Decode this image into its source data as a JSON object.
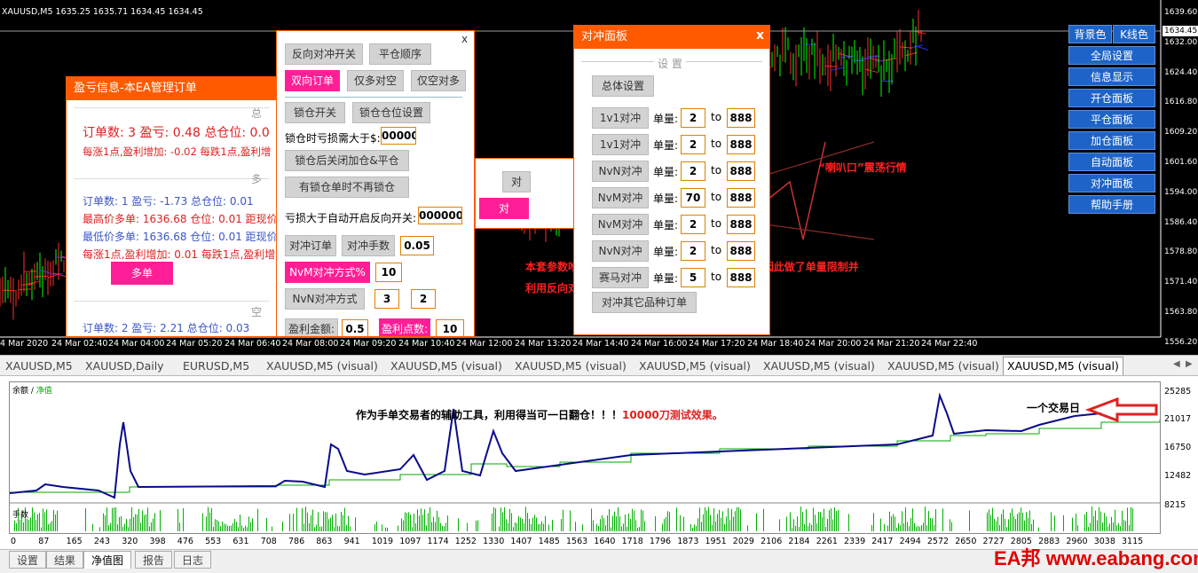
{
  "chart": {
    "symbol_line": "XAUUSD,M5  1635.25 1635.71 1634.45 1634.45",
    "price_labels": [
      "1639.60",
      "1632.00",
      "1624.40",
      "1616.80",
      "1609.20",
      "1601.60",
      "1594.00",
      "1586.40",
      "1578.80",
      "1571.40",
      "1563.80",
      "1556.20"
    ],
    "current_price": "1634.45",
    "time_labels": [
      "4 Mar 2020",
      "24 Mar 02:40",
      "24 Mar 04:00",
      "24 Mar 05:20",
      "24 Mar 06:40",
      "24 Mar 08:00",
      "24 Mar 09:20",
      "24 Mar 10:40",
      "24 Mar 12:00",
      "24 Mar 13:20",
      "24 Mar 14:40",
      "24 Mar 16:00",
      "24 Mar 17:20",
      "24 Mar 18:40",
      "24 Mar 20:00",
      "24 Mar 21:20",
      "24 Mar 22:40"
    ],
    "annotation_trumpet": "“喇叭口”震荡行情",
    "annotation_note_1": "本套参数唯一的缺陷是遇到“喇叭口”震荡会爆仓，因此做了单量限制并",
    "annotation_note_2": "利用反向对冲解套。"
  },
  "right_menu": {
    "bg_color_btn": "背景色",
    "kline_color_btn": "K线色",
    "items": [
      "全局设置",
      "信息显示",
      "开仓面板",
      "平仓面板",
      "加仓面板",
      "自动面板",
      "对冲面板",
      "帮助手册"
    ]
  },
  "profit_panel": {
    "title": "盈亏信息-本EA管理订单",
    "section_total": "总",
    "total_line": "订单数: 3  盈亏: 0.48  总仓位: 0.0",
    "total_sub": "每涨1点,盈利增加: -0.02    每跌1点,盈利增",
    "section_long": "多",
    "long_lines": [
      "订单数: 1  盈亏: -1.73  总仓位: 0.01",
      "最高价多单: 1636.68  仓位: 0.01  距现价",
      "最低价多单: 1636.68  仓位: 0.01  距现价",
      "每涨1点,盈利增加: 0.01    每跌1点,盈利增"
    ],
    "section_short": "空",
    "short_line": "订单数: 2  盈亏: 2.21  总仓位: 0.03",
    "btn_partial": "多单"
  },
  "settings_panel": {
    "close": "x",
    "btn_reverse_hedge": "反向对冲开关",
    "btn_close_order": "平仓顺序",
    "btn_two_way": "双向订单",
    "btn_long_vs_short": "仅多对空",
    "btn_short_vs_long": "仅空对多",
    "btn_lock_switch": "锁仓开关",
    "btn_lock_position": "锁仓仓位设置",
    "lock_loss_label": "锁仓时亏损需大于$:",
    "lock_loss_value": "000000",
    "btn_close_after_lock": "锁仓后关闭加仓&平仓",
    "btn_no_relock": "有锁仓单时不再锁仓",
    "auto_reverse_label": "亏损大于自动开启反向开关:",
    "auto_reverse_value": "0000000",
    "btn_hedge_order": "对冲订单",
    "btn_hedge_lots": "对冲手数",
    "hedge_lots_value": "0.05",
    "btn_nvm_pct": "NvM对冲方式%",
    "nvm_pct_value": "10",
    "btn_nvn_mode": "NvN对冲方式",
    "nvn_a": "3",
    "nvn_b": "2",
    "btn_profit_amount": "盈利金额:",
    "profit_amount_value": "0.5",
    "btn_profit_points": "盈利点数:",
    "profit_points_value": "10"
  },
  "hedge_panel": {
    "title": "对冲面板",
    "close": "x",
    "section_settings": "设 置",
    "btn_general": "总体设置",
    "rows": [
      {
        "btn": "1v1对冲",
        "label": "单量:",
        "from": "2",
        "to_text": "to",
        "to": "888"
      },
      {
        "btn": "1v1对冲",
        "label": "单量:",
        "from": "2",
        "to_text": "to",
        "to": "888"
      },
      {
        "btn": "NvN对冲",
        "label": "单量:",
        "from": "2",
        "to_text": "to",
        "to": "888"
      },
      {
        "btn": "NvM对冲",
        "label": "单量:",
        "from": "70",
        "to_text": "to",
        "to": "888"
      },
      {
        "btn": "NvM对冲",
        "label": "单量:",
        "from": "2",
        "to_text": "to",
        "to": "888"
      },
      {
        "btn": "NvN对冲",
        "label": "单量:",
        "from": "2",
        "to_text": "to",
        "to": "888"
      },
      {
        "btn": "赛马对冲",
        "label": "单量:",
        "from": "5",
        "to_text": "to",
        "to": "888"
      }
    ],
    "btn_other_symbols": "对冲其它品种订单"
  },
  "popup_fragment": {
    "text_1": "对",
    "text_2": "对"
  },
  "tabs": [
    "XAUUSD,M5",
    "XAUUSD,Daily",
    "EURUSD,M5",
    "XAUUSD,M5 (visual)",
    "XAUUSD,M5 (visual)",
    "XAUUSD,M5 (visual)",
    "XAUUSD,M5 (visual)",
    "XAUUSD,M5 (visual)",
    "XAUUSD,M5 (visual)",
    "XAUUSD,M5 (visual)"
  ],
  "active_tab": "XAUUSD,M5 (visual)",
  "tester": {
    "legend_balance": "余额",
    "legend_sep": " / ",
    "legend_equity": "净值",
    "caption_main": "作为手单交易者的辅助工具，利用得当可一日翻仓！！！",
    "caption_red": "10000刀测试效果。",
    "day_note": "一个交易日",
    "y_labels": [
      "25285",
      "21017",
      "16750",
      "12482",
      "8215"
    ],
    "lots_label": "手数",
    "x_ticks": [
      "0",
      "87",
      "165",
      "243",
      "320",
      "398",
      "476",
      "553",
      "631",
      "708",
      "786",
      "863",
      "941",
      "1019",
      "1097",
      "1174",
      "1252",
      "1330",
      "1407",
      "1485",
      "1563",
      "1640",
      "1718",
      "1796",
      "1873",
      "1951",
      "2029",
      "2106",
      "2184",
      "2261",
      "2339",
      "2417",
      "2494",
      "2572",
      "2650",
      "2727",
      "2805",
      "2883",
      "2960",
      "3038",
      "3115"
    ]
  },
  "bottom_tabs": [
    "设置",
    "结果",
    "净值图",
    "报告",
    "日志"
  ],
  "active_bottom_tab": "净值图",
  "watermark": "EA邦 www.eabang.com",
  "colors": {
    "panel_orange": "#ff5a00",
    "button_pink": "#ff1e96",
    "menu_blue": "#1e64c8",
    "balance_line": "#0a0a8a",
    "equity_line": "#00aa00"
  }
}
